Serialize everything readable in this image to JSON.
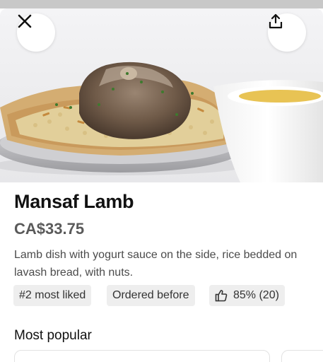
{
  "item": {
    "title": "Mansaf Lamb",
    "price": "CA$33.75",
    "description": "Lamb dish with yogurt sauce on the side, rice bedded on lavash bread, with nuts."
  },
  "tags": {
    "rank": "#2 most liked",
    "ordered": "Ordered before",
    "rating": "85% (20)"
  },
  "section": {
    "title": "Most popular"
  },
  "icons": {
    "close": "close-icon",
    "share": "share-icon",
    "thumbs_up": "thumbs-up-icon"
  },
  "colors": {
    "text_primary": "#111111",
    "text_secondary": "#5a5a5a",
    "chip_bg": "#eeeeee"
  }
}
